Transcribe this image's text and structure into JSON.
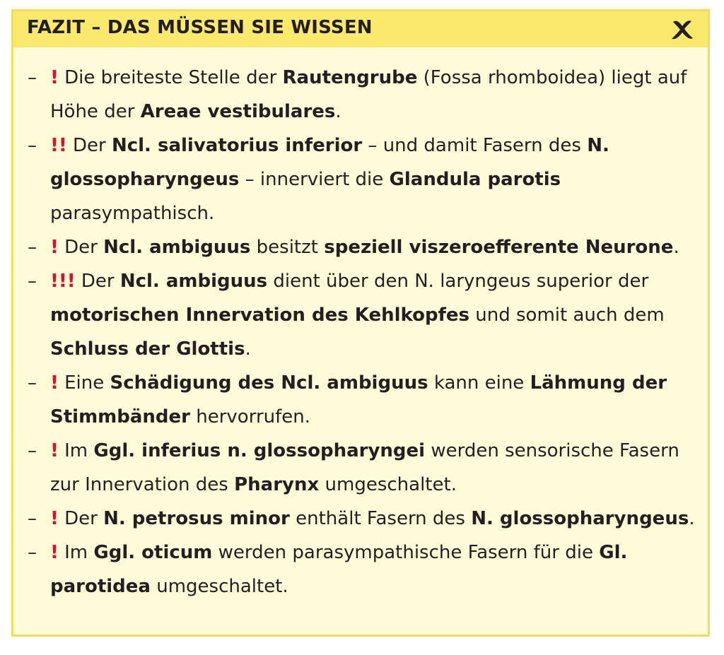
{
  "header": {
    "title": "FAZIT – DAS MÜSSEN SIE WISSEN",
    "icon": "cross-x-icon",
    "accent_color": "#fbe96d",
    "background_color": "#fffbd9",
    "exclamation_color": "#d8112a"
  },
  "dash": "–",
  "items": [
    {
      "importance": "!",
      "segments": [
        {
          "t": "Die breiteste Stelle der ",
          "b": false
        },
        {
          "t": "Rautengrube",
          "b": true
        },
        {
          "t": " (Fossa rhomboidea) liegt auf Höhe der ",
          "b": false
        },
        {
          "t": "Areae vestibulares",
          "b": true
        },
        {
          "t": ".",
          "b": false
        }
      ]
    },
    {
      "importance": "!!",
      "segments": [
        {
          "t": "Der ",
          "b": false
        },
        {
          "t": "Ncl. salivatorius inferior",
          "b": true
        },
        {
          "t": " – und damit Fasern des ",
          "b": false
        },
        {
          "t": "N. glossopharyngeus",
          "b": true
        },
        {
          "t": " – innerviert die ",
          "b": false
        },
        {
          "t": "Glandula parotis",
          "b": true
        },
        {
          "t": " parasympathisch.",
          "b": false
        }
      ]
    },
    {
      "importance": "!",
      "segments": [
        {
          "t": "Der ",
          "b": false
        },
        {
          "t": "Ncl. ambiguus",
          "b": true
        },
        {
          "t": " besitzt ",
          "b": false
        },
        {
          "t": "speziell viszeroefferente Neurone",
          "b": true
        },
        {
          "t": ".",
          "b": false
        }
      ]
    },
    {
      "importance": "!!!",
      "segments": [
        {
          "t": "Der ",
          "b": false
        },
        {
          "t": "Ncl. ambiguus",
          "b": true
        },
        {
          "t": " dient über den N. laryngeus superior der ",
          "b": false
        },
        {
          "t": "motorischen Innervation des Kehlkopfes",
          "b": true
        },
        {
          "t": " und somit auch dem ",
          "b": false
        },
        {
          "t": "Schluss der Glottis",
          "b": true
        },
        {
          "t": ".",
          "b": false
        }
      ]
    },
    {
      "importance": "!",
      "segments": [
        {
          "t": "Eine ",
          "b": false
        },
        {
          "t": "Schädigung des Ncl. ambiguus",
          "b": true
        },
        {
          "t": " kann eine ",
          "b": false
        },
        {
          "t": "Lähmung der Stimmbänder",
          "b": true
        },
        {
          "t": " hervorrufen.",
          "b": false
        }
      ]
    },
    {
      "importance": "!",
      "segments": [
        {
          "t": "Im ",
          "b": false
        },
        {
          "t": "Ggl. inferius n. glossopharyngei",
          "b": true
        },
        {
          "t": " werden sensorische Fasern zur Innervation des ",
          "b": false
        },
        {
          "t": "Pharynx",
          "b": true
        },
        {
          "t": " umgeschaltet.",
          "b": false
        }
      ]
    },
    {
      "importance": "!",
      "segments": [
        {
          "t": "Der ",
          "b": false
        },
        {
          "t": "N. petrosus minor",
          "b": true
        },
        {
          "t": " enthält Fasern des ",
          "b": false
        },
        {
          "t": "N. glossopharyngeus",
          "b": true
        },
        {
          "t": ".",
          "b": false
        }
      ]
    },
    {
      "importance": "!",
      "segments": [
        {
          "t": "Im ",
          "b": false
        },
        {
          "t": "Ggl. oticum",
          "b": true
        },
        {
          "t": " werden parasympathische Fasern für die ",
          "b": false
        },
        {
          "t": "Gl. parotidea",
          "b": true
        },
        {
          "t": " umgeschaltet.",
          "b": false
        }
      ]
    }
  ]
}
